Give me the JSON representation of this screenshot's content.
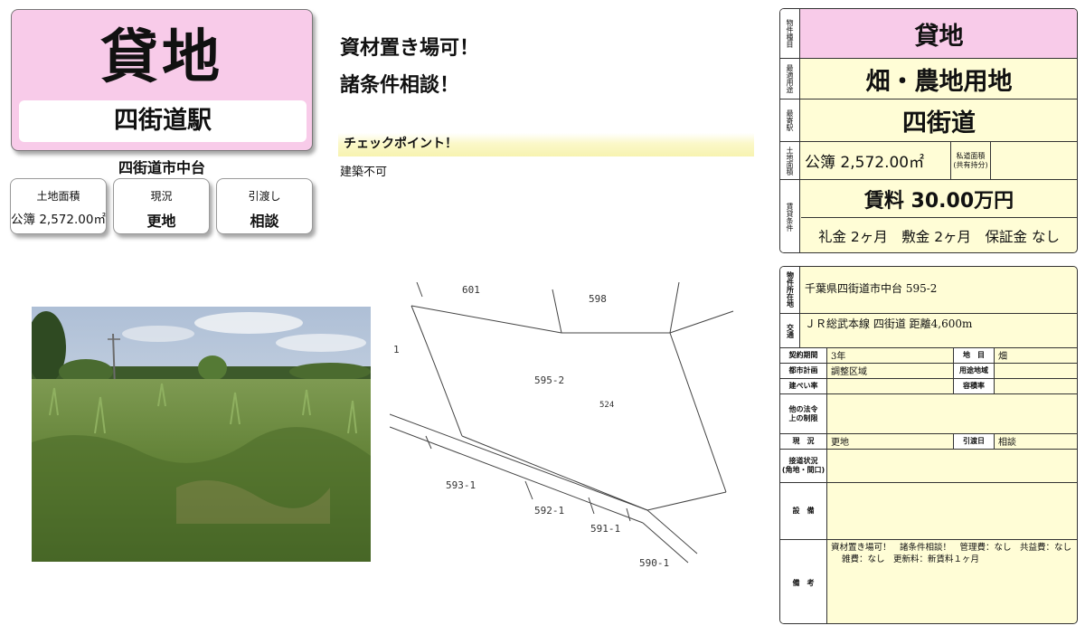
{
  "title": {
    "main": "貸地",
    "station": "四街道駅"
  },
  "address_short": "四街道市中台",
  "cards": [
    {
      "label": "土地面積",
      "value": "公簿 2,572.00㎡"
    },
    {
      "label": "現況",
      "value": "更地"
    },
    {
      "label": "引渡し",
      "value": "相談"
    }
  ],
  "catchcopy": {
    "line1": "資材置き場可！",
    "line2": "諸条件相談！"
  },
  "checkpoint": {
    "heading": "チェックポイント！",
    "body": "建築不可"
  },
  "plan_labels": {
    "p601": "601",
    "p598": "598",
    "p595_2": "595-2",
    "p524": "524",
    "p593_1": "593-1",
    "p592_1": "592-1",
    "p591_1": "591-1",
    "p590_1": "590-1",
    "p1": "1"
  },
  "spec": {
    "type_label": "物件種目",
    "type": "貸地",
    "use_label": "最適用途",
    "use": "畑・農地用地",
    "station_label": "最寄駅",
    "station": "四街道",
    "area_label": "土地面積",
    "area": "公簿 2,572.00㎡",
    "private_road_label": "私道面積\n(共有持分)",
    "rent_label": "賃貸条件",
    "rent": "賃料 30.00万円",
    "fees": "礼金 2ヶ月　敷金 2ヶ月　保証金 なし"
  },
  "details": {
    "location_label": "物件所在地",
    "location": "千葉県四街道市中台 595-2",
    "transport_label": "交通",
    "transport": "ＪＲ総武本線 四街道 距離4,600m",
    "contract_label": "契約期間",
    "contract": "3年",
    "chimoku_label": "地　目",
    "chimoku": "畑",
    "city_plan_label": "都市計画",
    "city_plan": "調整区域",
    "zoning_label": "用途地域",
    "zoning": "",
    "bcr_label": "建ぺい率",
    "bcr": "",
    "far_label": "容積率",
    "far": "",
    "other_law_label": "他の法令\n上の制限",
    "other_law": "",
    "status_label": "現　況",
    "status": "更地",
    "delivery_label": "引渡日",
    "delivery": "相談",
    "road_label": "接道状況\n(角地・間口)",
    "road": "",
    "facility_label": "設　備",
    "facility": "",
    "remarks_label": "備　考",
    "remarks_line1": "資材置き場可！　諸条件相談！　管理費：なし　共益費：なし",
    "remarks_line2": "雑費：なし　更新料：新賃料１ヶ月"
  }
}
